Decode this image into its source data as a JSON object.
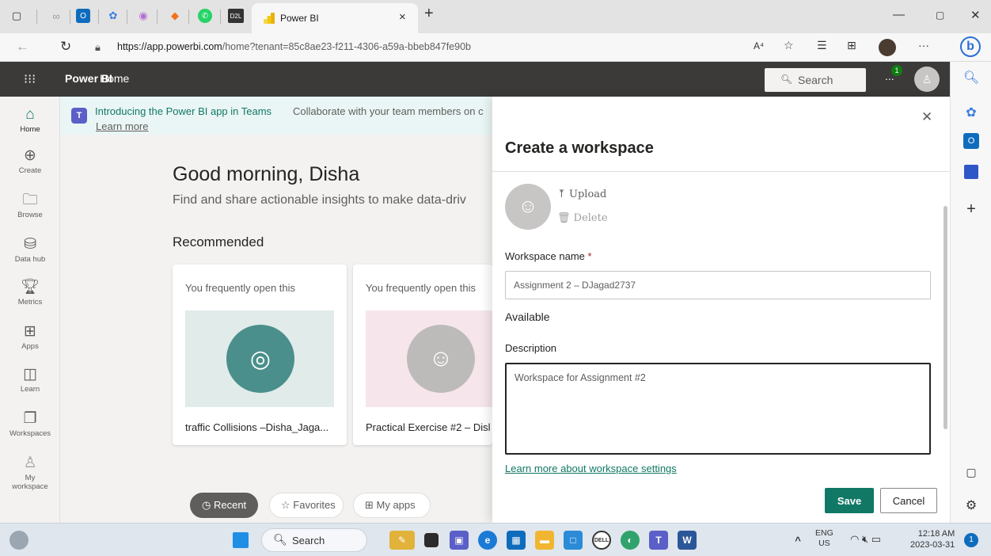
{
  "browser": {
    "tab_title": "Power BI",
    "tab_close": "×",
    "new_tab": "+",
    "url_domain": "https://app.powerbi.com",
    "url_path": "/home?tenant=85c8ae23-f211-4306-a59a-bbeb847fe90b",
    "read_aloud": "A⁴",
    "more": "···"
  },
  "header": {
    "brand": "Power BI",
    "crumb": "Home",
    "search_placeholder": "Search",
    "notifications_count": "1",
    "more": "..."
  },
  "leftnav": {
    "items": [
      {
        "label": "Home",
        "icon": "home-icon"
      },
      {
        "label": "Create",
        "icon": "plus-circle-icon"
      },
      {
        "label": "Browse",
        "icon": "folder-icon"
      },
      {
        "label": "Data hub",
        "icon": "data-hub-icon"
      },
      {
        "label": "Metrics",
        "icon": "trophy-icon"
      },
      {
        "label": "Apps",
        "icon": "apps-icon"
      },
      {
        "label": "Learn",
        "icon": "book-icon"
      },
      {
        "label": "Workspaces",
        "icon": "workspaces-icon"
      },
      {
        "label": "My",
        "label2": "workspace",
        "icon": "person-icon"
      }
    ]
  },
  "banner": {
    "title": "Introducing the Power BI app in Teams",
    "desc": "Collaborate with your team members on c",
    "learn": "Learn more"
  },
  "main": {
    "greeting": "Good morning, Disha",
    "subtitle": "Find and share actionable insights to make data-driv",
    "recommended": "Recommended",
    "cards": [
      {
        "hint": "You frequently open this",
        "name": "traffic Collisions –Disha_Jaga...",
        "icon": "gauge-icon",
        "thumb_bg": "#e0ebea",
        "circle_bg": "#4a8f8b"
      },
      {
        "hint": "You frequently open this",
        "name": "Practical Exercise #2 – Disl",
        "icon": "workspace-icon",
        "thumb_bg": "#f6e6ec",
        "circle_bg": "#bdbbb9"
      }
    ],
    "pills": {
      "recent": "Recent",
      "favorites": "Favorites",
      "myapps": "My apps"
    }
  },
  "panel": {
    "title": "Create a workspace",
    "upload": "Upload",
    "delete": "Delete",
    "name_label": "Workspace name",
    "required_mark": "*",
    "name_value": "Assignment 2 – DJagad2737",
    "available": "Available",
    "desc_label": "Description",
    "desc_value": "Workspace for Assignment #2",
    "learn_link": "Learn more about workspace settings",
    "save": "Save",
    "cancel": "Cancel"
  },
  "taskbar": {
    "search": "Search",
    "lang_top": "ENG",
    "lang_bottom": "US",
    "time": "12:18 AM",
    "date": "2023-03-31",
    "badge": "1"
  },
  "colors": {
    "accent": "#117865",
    "header": "#3b3a39",
    "banner": "#eaf6f5"
  }
}
